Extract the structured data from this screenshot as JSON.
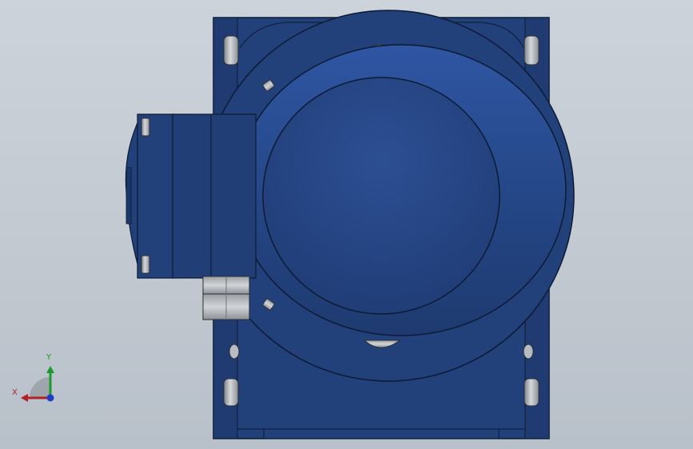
{
  "viewport": {
    "colors": {
      "housing": "#22407a",
      "housing_dark": "#1a3265",
      "housing_light": "#2f55a0",
      "bolt": "#a9aeb3",
      "background": "#c6cdd5"
    }
  },
  "triad": {
    "x_label": "X",
    "y_label": "Y",
    "x_color": "#b22222",
    "y_color": "#1a9a2a",
    "z_color": "#1e3cc8"
  }
}
